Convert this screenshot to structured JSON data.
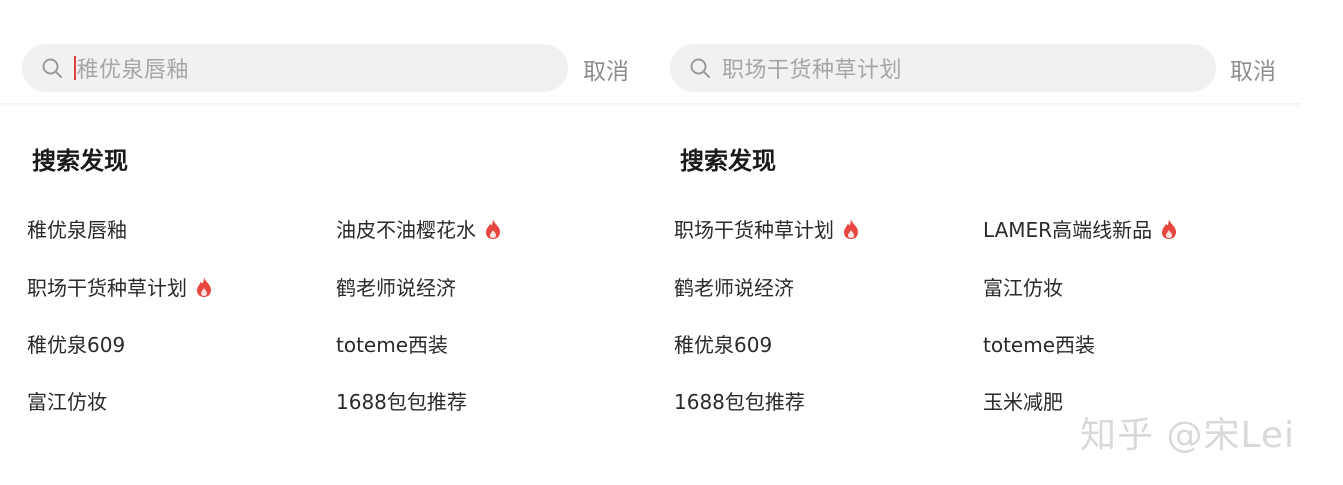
{
  "left": {
    "search": {
      "placeholder": "稚优泉唇釉",
      "cancel_label": "取消"
    },
    "section_title": "搜索发现",
    "items": [
      {
        "label": "稚优泉唇釉",
        "hot": false
      },
      {
        "label": "油皮不油樱花水",
        "hot": true
      },
      {
        "label": "职场干货种草计划",
        "hot": true
      },
      {
        "label": "鹤老师说经济",
        "hot": false
      },
      {
        "label": "稚优泉609",
        "hot": false
      },
      {
        "label": "toteme西装",
        "hot": false
      },
      {
        "label": "富江仿妆",
        "hot": false
      },
      {
        "label": "1688包包推荐",
        "hot": false
      }
    ]
  },
  "right": {
    "search": {
      "placeholder": "职场干货种草计划",
      "cancel_label": "取消"
    },
    "section_title": "搜索发现",
    "items": [
      {
        "label": "职场干货种草计划",
        "hot": true
      },
      {
        "label": "LAMER高端线新品",
        "hot": true
      },
      {
        "label": "鹤老师说经济",
        "hot": false
      },
      {
        "label": "富江仿妆",
        "hot": false
      },
      {
        "label": "稚优泉609",
        "hot": false
      },
      {
        "label": "toteme西装",
        "hot": false
      },
      {
        "label": "1688包包推荐",
        "hot": false
      },
      {
        "label": "玉米减肥",
        "hot": false
      }
    ]
  },
  "watermark": "知乎 @宋Lei",
  "colors": {
    "accent": "#e0403a",
    "search_bg": "#f1f1f1",
    "muted_text": "#a6a6a6"
  },
  "icons": {
    "search": "search-icon",
    "hot": "fire-icon"
  }
}
